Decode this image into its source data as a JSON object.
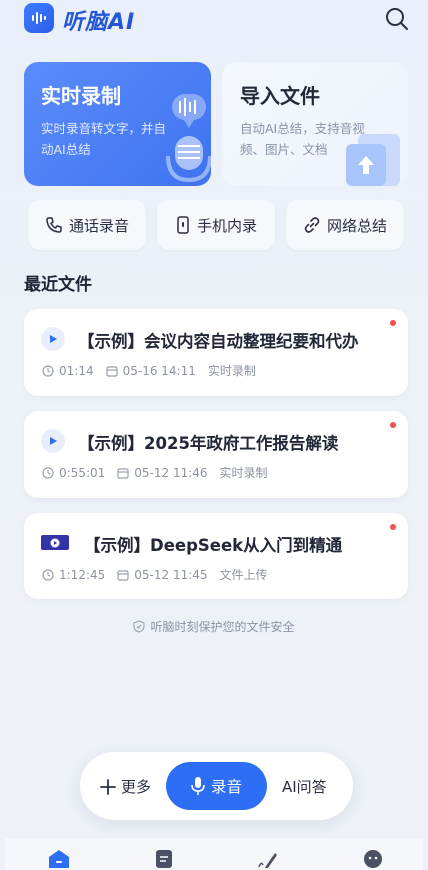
{
  "header": {
    "brand": "听脑AI",
    "search_icon": "search-icon"
  },
  "features": {
    "record": {
      "title": "实时录制",
      "desc": "实时录音转文字，并自动AI总结"
    },
    "import": {
      "title": "导入文件",
      "desc": "自动AI总结，支持音视频、图片、文档"
    }
  },
  "quick_actions": [
    {
      "label": "通话录音",
      "icon": "phone-icon"
    },
    {
      "label": "手机内录",
      "icon": "phone-record-icon"
    },
    {
      "label": "网络总结",
      "icon": "link-icon"
    }
  ],
  "recent": {
    "title": "最近文件",
    "files": [
      {
        "title": "【示例】会议内容自动整理纪要和代办",
        "duration": "01:14",
        "date": "05-16 14:11",
        "source": "实时录制",
        "unread": true
      },
      {
        "title": "【示例】2025年政府工作报告解读",
        "duration": "0:55:01",
        "date": "05-12 11:46",
        "source": "实时录制",
        "unread": true
      },
      {
        "title": "【示例】DeepSeek从入门到精通",
        "duration": "1:12:45",
        "date": "05-12 11:45",
        "source": "文件上传",
        "unread": true
      }
    ]
  },
  "safety_note": "听脑时刻保护您的文件安全",
  "action_bar": {
    "more": "更多",
    "record": "录音",
    "ai": "AI问答"
  },
  "colors": {
    "accent": "#2d6ef5",
    "unread_dot": "#f0504f"
  }
}
